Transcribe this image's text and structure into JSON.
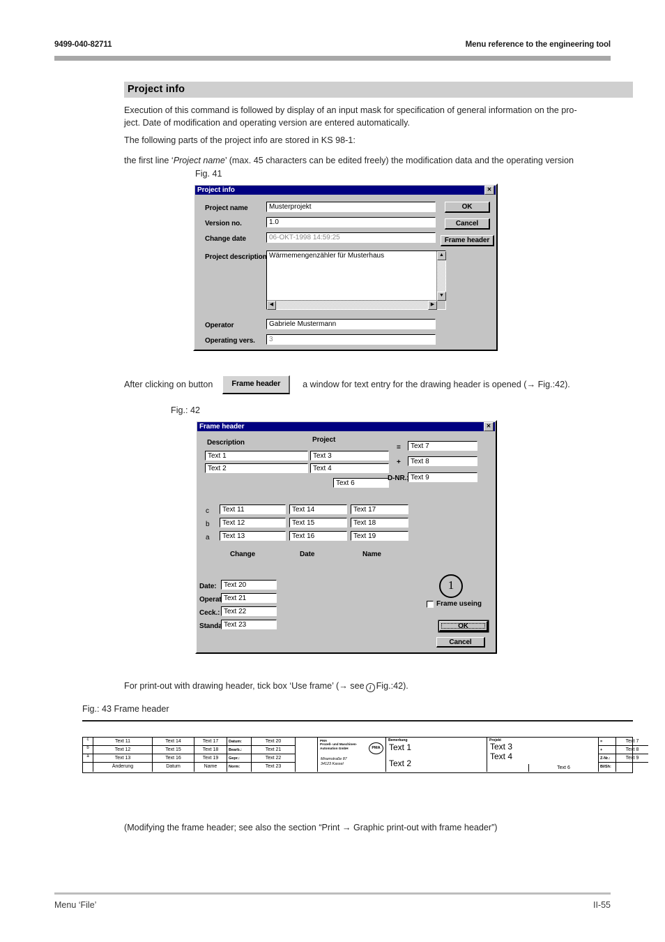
{
  "header": {
    "doc_number": "9499-040-82711",
    "chapter_title": "Menu reference to the engineering tool"
  },
  "section": {
    "title": "Project  info"
  },
  "body": {
    "p1_a": "Execution of this command is followed by display of an input mask for specification of general information on the pro",
    "p1_b": "-",
    "p1_c": "ject. Date of modification and operating version are entered automatically.",
    "p2": "The following parts of the project info are stored in KS 98-1:",
    "p3_a": "the first line ‘",
    "p3_i": "Project name",
    "p3_b": "’ (max. 45 characters can be edited freely) the modification data and the operating version",
    "fig41_caption": "Fig. 41",
    "after_a": "After clicking on button",
    "after_btn": "Frame header",
    "after_b": "a window for text entry for the drawing header is opened  (→ Fig.:42).",
    "fig42_caption": "Fig.: 42",
    "print_a": "For print-out with drawing header, tick box ‘Use frame’ (→ see",
    "print_b": "Fig.:42).",
    "fig43_caption": "Fig.: 43 Frame header",
    "modify": "(Modifying the frame header; see also the section “Print → Graphic print-out with frame header”)"
  },
  "footer": {
    "left": "Menu ‘File’",
    "right": "II-55"
  },
  "project_info_dialog": {
    "title": "Project info",
    "close_label": "✕",
    "labels": {
      "project_name": "Project name",
      "version_no": "Version no.",
      "change_date": "Change date",
      "project_description": "Project description",
      "operator": "Operator",
      "operating_vers": "Operating vers."
    },
    "values": {
      "project_name": "Musterprojekt",
      "version_no": "1.0",
      "change_date": "06-OKT-1998 14:59:25",
      "project_description": "Wärmemengenzähler für Musterhaus",
      "operator": "Gabriele Mustermann",
      "operating_vers": "3"
    },
    "buttons": {
      "ok": "OK",
      "cancel": "Cancel",
      "frame_header": "Frame header"
    }
  },
  "frame_header_dialog": {
    "title": "Frame header",
    "close_label": "✕",
    "labels": {
      "description": "Description",
      "project": "Project",
      "equals": "=",
      "plus": "+",
      "dnr": "D-NR.:",
      "row_c": "c",
      "row_b": "b",
      "row_a": "a",
      "col_change": "Change",
      "col_date": "Date",
      "col_name": "Name",
      "date": "Date:",
      "operator": "Operato",
      "check": "Ceck.:",
      "standard": "Standar",
      "frame_using": "Frame useing",
      "circle_one": "1"
    },
    "values": {
      "text1": "Text 1",
      "text2": "Text 2",
      "text3": "Text 3",
      "text4": "Text 4",
      "text6": "Text 6",
      "text7": "Text 7",
      "text8": "Text 8",
      "text9": "Text 9",
      "text11": "Text 11",
      "text12": "Text 12",
      "text13": "Text 13",
      "text14": "Text 14",
      "text15": "Text 15",
      "text16": "Text 16",
      "text17": "Text 17",
      "text18": "Text 18",
      "text19": "Text 19",
      "text20": "Text 20",
      "text21": "Text 21",
      "text22": "Text 22",
      "text23": "Text 23"
    },
    "buttons": {
      "ok": "OK",
      "cancel": "Cancel"
    }
  },
  "frame_table": {
    "rev_rows": [
      {
        "rev": "c",
        "change": "Text 11",
        "date": "Text 14",
        "name": "Text 17",
        "lbl": "Datum:",
        "val": "Text 20"
      },
      {
        "rev": "b",
        "change": "Text 12",
        "date": "Text 15",
        "name": "Text 18",
        "lbl": "Bearb.:",
        "val": "Text 21"
      },
      {
        "rev": "a",
        "change": "Text 13",
        "date": "Text 16",
        "name": "Text 19",
        "lbl": "Gepr.:",
        "val": "Text 22"
      },
      {
        "rev": "",
        "change": "Änderung",
        "date": "Datum",
        "name": "Name",
        "lbl": "Norm:",
        "val": "Text 23"
      }
    ],
    "company": {
      "line1": "PMA",
      "line2": "Prozeß- und Maschinen-",
      "line3": "Automation GmbH",
      "line4": "Miramstraße 87",
      "line5": "34123 Kassel",
      "logo": "PMA"
    },
    "remark_label": "Bemerkung",
    "remark_1": "Text 1",
    "remark_2": "Text 2",
    "project_label": "Projekt",
    "project_1": "Text 3",
    "project_2": "Text 4",
    "project_3": "Text 6",
    "right_rows": [
      {
        "lbl": "=",
        "val": "Text 7"
      },
      {
        "lbl": "+",
        "val": "Text 8"
      },
      {
        "lbl": "Z-Nr.:",
        "val": "Text 9"
      },
      {
        "lbl": "Bl/Sh:",
        "val": ""
      }
    ]
  },
  "colors": {
    "title_bar": "#000080",
    "dialog_face": "#c4c4c4",
    "band": "#cfcfcf",
    "rule": "#a8a8a8"
  }
}
